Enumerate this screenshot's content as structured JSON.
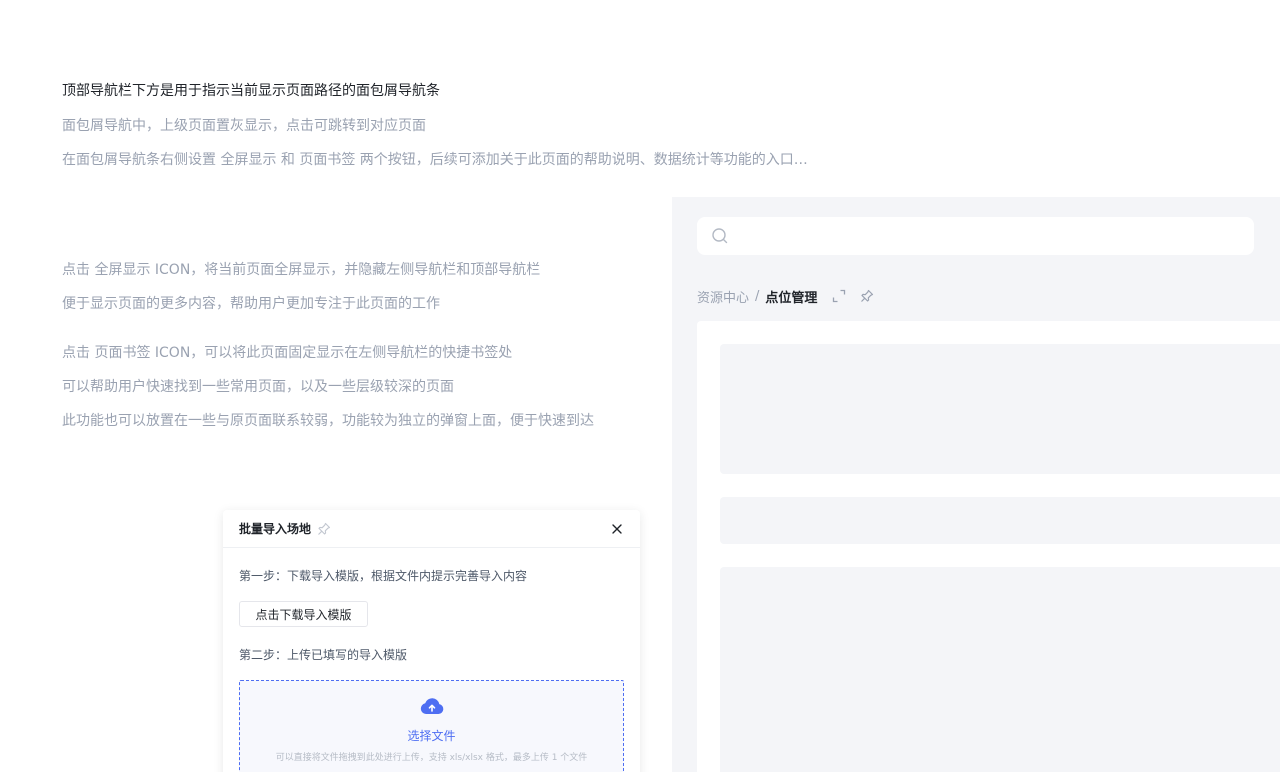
{
  "description": {
    "heading": "顶部导航栏下方是用于指示当前显示页面路径的面包屑导航条",
    "line1": "面包屑导航中，上级页面置灰显示，点击可跳转到对应页面",
    "line2": "在面包屑导航条右侧设置 全屏显示 和 页面书签 两个按钮，后续可添加关于此页面的帮助说明、数据统计等功能的入口…",
    "fullscreen_line1": "点击 全屏显示 ICON，将当前页面全屏显示，并隐藏左侧导航栏和顶部导航栏",
    "fullscreen_line2": "便于显示页面的更多内容，帮助用户更加专注于此页面的工作",
    "bookmark_line1": "点击 页面书签 ICON，可以将此页面固定显示在左侧导航栏的快捷书签处",
    "bookmark_line2": "可以帮助用户快速找到一些常用页面，以及一些层级较深的页面",
    "bookmark_line3": "此功能也可以放置在一些与原页面联系较弱，功能较为独立的弹窗上面，便于快速到达"
  },
  "preview": {
    "search": {
      "icon": "search-icon",
      "placeholder": ""
    },
    "breadcrumb": {
      "parent": "资源中心",
      "separator": "/",
      "current": "点位管理",
      "fullscreen_icon": "fullscreen-icon",
      "bookmark_icon": "pin-icon"
    }
  },
  "modal": {
    "title": "批量导入场地",
    "pin_icon": "pin-icon",
    "close_icon": "close-icon",
    "step1": "第一步：下载导入模版，根据文件内提示完善导入内容",
    "download_button": "点击下载导入模版",
    "step2": "第二步：上传已填写的导入模版",
    "upload": {
      "icon": "cloud-upload-icon",
      "label": "选择文件",
      "hint": "可以直接将文件拖拽到此处进行上传，支持 xls/xlsx 格式，最多上传 1 个文件"
    }
  },
  "colors": {
    "accent": "#4e6ef2",
    "text_primary": "#1f2329",
    "text_secondary": "#9aa2b1",
    "panel_bg": "#f4f5f8"
  }
}
